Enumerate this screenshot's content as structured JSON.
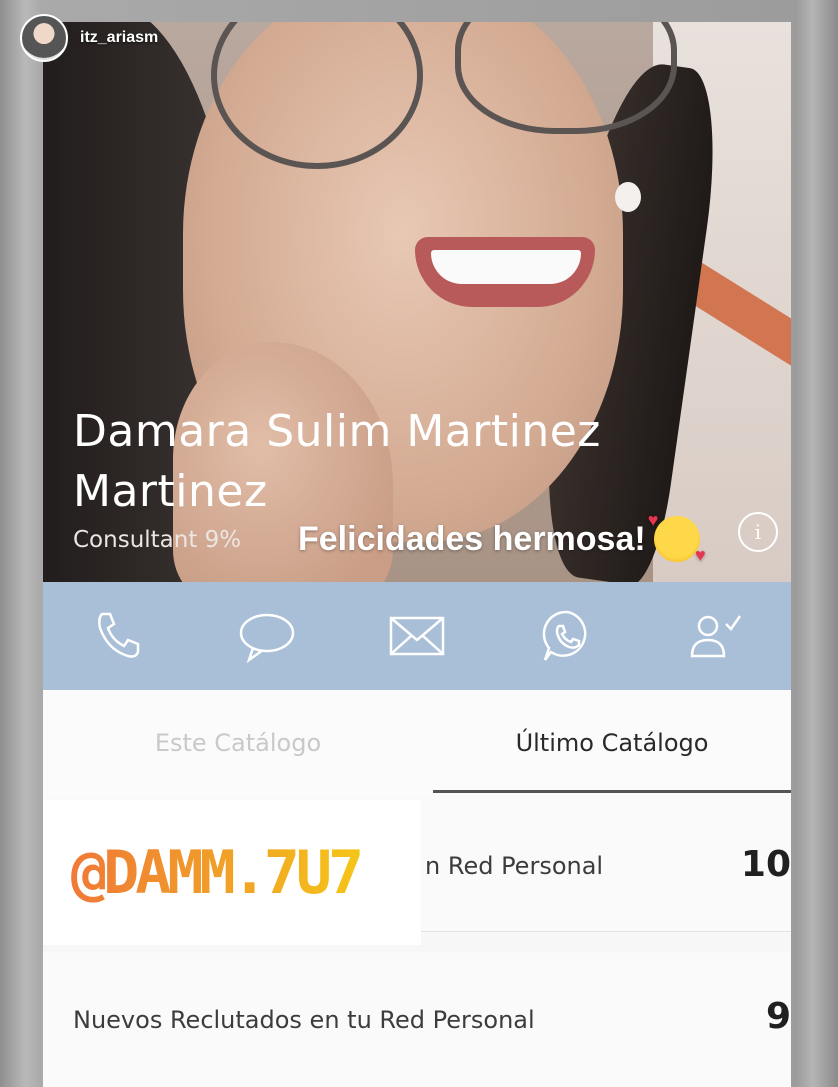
{
  "story": {
    "username": "itz_ariasm"
  },
  "profile": {
    "name_line1": "Damara Sulim Martinez",
    "name_line2": "Martinez",
    "role": "Consultant 9%"
  },
  "sticker": {
    "text": "Felicidades hermosa!",
    "emoji": "smiling-face-with-hearts"
  },
  "info_icon": "i",
  "actions": [
    "phone-icon",
    "chat-bubble-icon",
    "mail-icon",
    "whatsapp-icon",
    "user-check-icon"
  ],
  "tabs": [
    {
      "label": "Este Catálogo",
      "active": false
    },
    {
      "label": "Último Catálogo",
      "active": true
    }
  ],
  "rows": [
    {
      "label": "n Red Personal",
      "value": "10"
    },
    {
      "label": "Nuevos Reclutados en tu Red Personal",
      "value": "9"
    }
  ],
  "overlay_handle": "@DAMM.7U7",
  "colors": {
    "action_bar": "#a9bfd7",
    "handle_gradient": [
      "#f0723a",
      "#f5c518"
    ]
  }
}
